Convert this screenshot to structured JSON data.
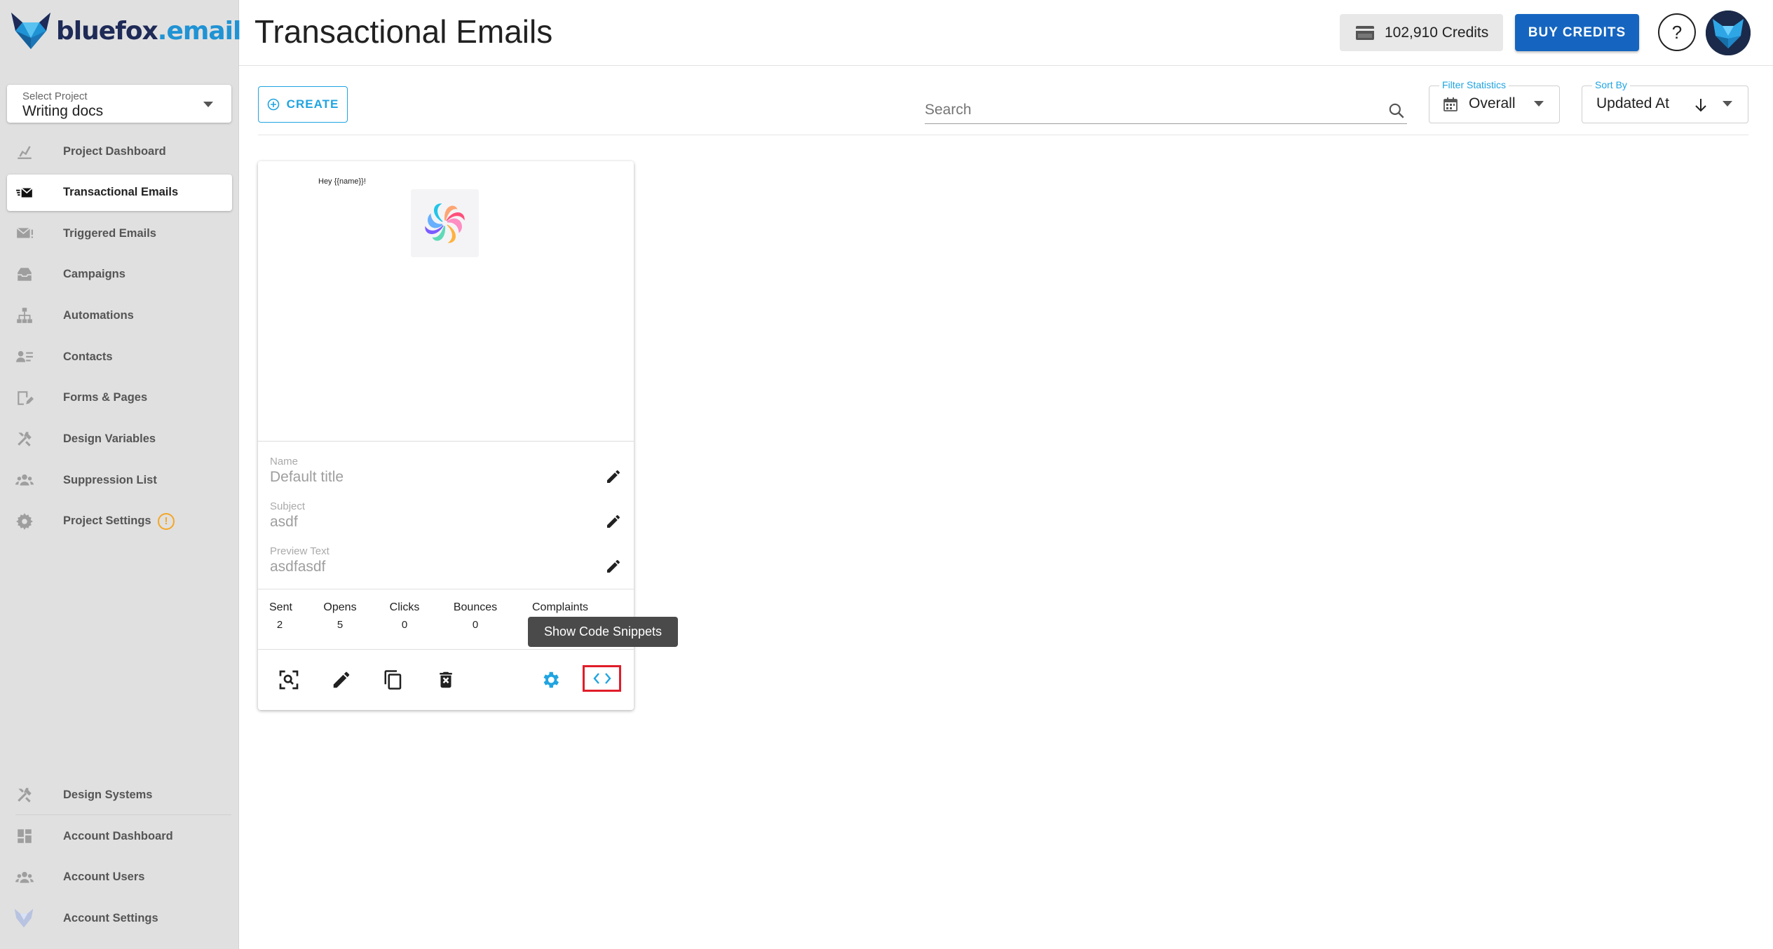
{
  "app": {
    "logo_text_main": "bluefox",
    "logo_text_dot": ".email",
    "page_title": "Transactional Emails"
  },
  "project_select": {
    "label": "Select Project",
    "value": "Writing docs"
  },
  "sidebar": {
    "items": [
      {
        "label": "Project Dashboard",
        "icon": "chart-icon"
      },
      {
        "label": "Transactional Emails",
        "icon": "mail-fast-icon",
        "active": true
      },
      {
        "label": "Triggered Emails",
        "icon": "mail-alert-icon"
      },
      {
        "label": "Campaigns",
        "icon": "inbox-icon"
      },
      {
        "label": "Automations",
        "icon": "sitemap-icon"
      },
      {
        "label": "Contacts",
        "icon": "contacts-icon"
      },
      {
        "label": "Forms & Pages",
        "icon": "form-edit-icon"
      },
      {
        "label": "Design Variables",
        "icon": "tools-icon"
      },
      {
        "label": "Suppression List",
        "icon": "users-off-icon"
      },
      {
        "label": "Project Settings",
        "icon": "gear-icon",
        "badge": "!"
      }
    ],
    "bottom_items": [
      {
        "label": "Design Systems",
        "icon": "tools-icon"
      },
      {
        "label": "Account Dashboard",
        "icon": "dashboard-icon"
      },
      {
        "label": "Account Users",
        "icon": "users-icon"
      },
      {
        "label": "Account Settings",
        "icon": "fox-icon"
      }
    ]
  },
  "header": {
    "credits": "102,910 Credits",
    "buy_credits": "BUY CREDITS",
    "help": "?"
  },
  "toolbar": {
    "create_label": "CREATE",
    "search_placeholder": "Search",
    "filter_label": "Filter Statistics",
    "filter_value": "Overall",
    "sort_label": "Sort By",
    "sort_value": "Updated At"
  },
  "card": {
    "preview_greeting": "Hey {{name}}!",
    "fields": [
      {
        "label": "Name",
        "value": "Default title"
      },
      {
        "label": "Subject",
        "value": "asdf"
      },
      {
        "label": "Preview Text",
        "value": "asdfasdf"
      }
    ],
    "stats": [
      {
        "label": "Sent",
        "value": "2"
      },
      {
        "label": "Opens",
        "value": "5"
      },
      {
        "label": "Clicks",
        "value": "0"
      },
      {
        "label": "Bounces",
        "value": "0"
      },
      {
        "label": "Complaints",
        "value": ""
      }
    ],
    "tooltip": "Show Code Snippets"
  },
  "colors": {
    "accent": "#1fa4e0",
    "primary_button": "#1565c0",
    "highlight": "#e11d2a",
    "warning": "#f5a623"
  }
}
